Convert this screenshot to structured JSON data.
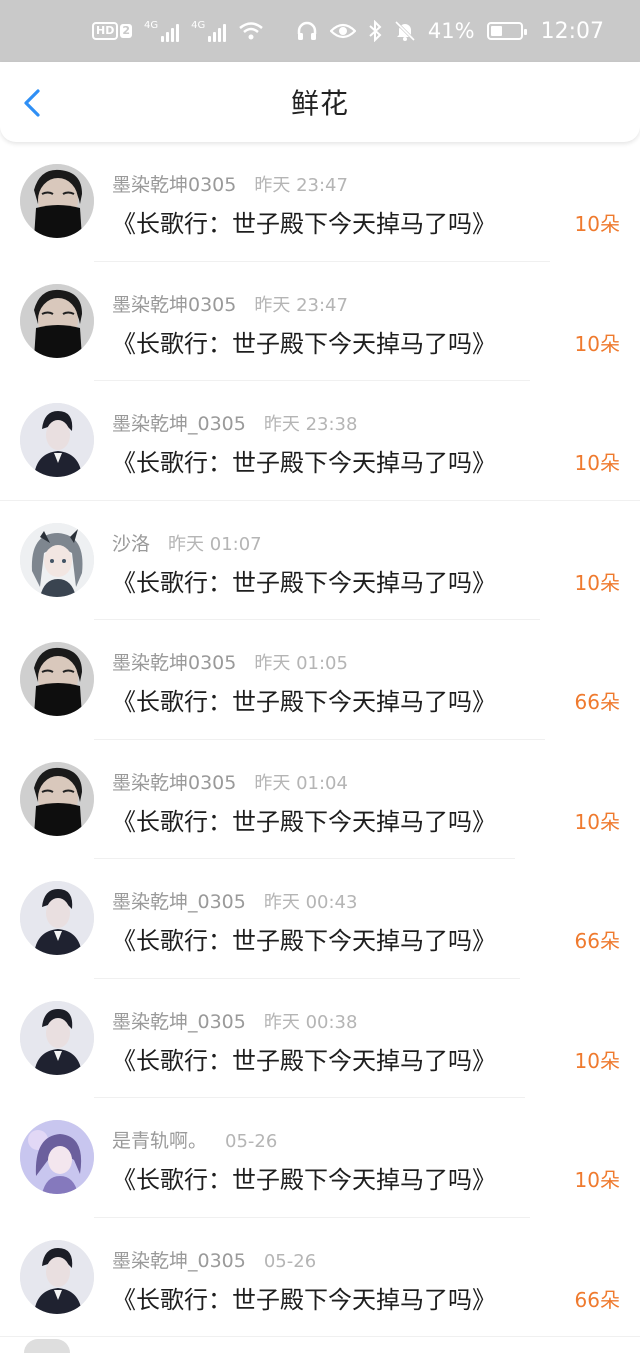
{
  "status": {
    "hd": "HD",
    "sim": "2",
    "net1": "4G",
    "net2": "4G",
    "battery_pct": "41%",
    "battery_level": 0.41,
    "time": "12:07",
    "icons": [
      "headphones-icon",
      "eye-icon",
      "bluetooth-icon",
      "bell-off-icon",
      "wifi-icon"
    ]
  },
  "nav": {
    "title": "鲜花",
    "back_icon": "chevron-left-icon"
  },
  "colors": {
    "accent": "#2f8ff5",
    "count": "#ef7a2e"
  },
  "items": [
    {
      "name": "墨染乾坤0305",
      "time": "昨天 23:47",
      "book": "《长歌行：世子殿下今天掉马了吗》",
      "count": "10朵",
      "avatar": "avatar-masked-man"
    },
    {
      "name": "墨染乾坤0305",
      "time": "昨天 23:47",
      "book": "《长歌行：世子殿下今天掉马了吗》",
      "count": "10朵",
      "avatar": "avatar-masked-man"
    },
    {
      "name": "墨染乾坤_0305",
      "time": "昨天 23:38",
      "book": "《长歌行：世子殿下今天掉马了吗》",
      "count": "10朵",
      "avatar": "avatar-dark-suit"
    },
    {
      "name": "沙洛",
      "time": "昨天 01:07",
      "book": "《长歌行：世子殿下今天掉马了吗》",
      "count": "10朵",
      "avatar": "avatar-anime-girl"
    },
    {
      "name": "墨染乾坤0305",
      "time": "昨天 01:05",
      "book": "《长歌行：世子殿下今天掉马了吗》",
      "count": "66朵",
      "avatar": "avatar-masked-man"
    },
    {
      "name": "墨染乾坤0305",
      "time": "昨天 01:04",
      "book": "《长歌行：世子殿下今天掉马了吗》",
      "count": "10朵",
      "avatar": "avatar-masked-man"
    },
    {
      "name": "墨染乾坤_0305",
      "time": "昨天 00:43",
      "book": "《长歌行：世子殿下今天掉马了吗》",
      "count": "66朵",
      "avatar": "avatar-dark-suit"
    },
    {
      "name": "墨染乾坤_0305",
      "time": "昨天 00:38",
      "book": "《长歌行：世子殿下今天掉马了吗》",
      "count": "10朵",
      "avatar": "avatar-dark-suit"
    },
    {
      "name": "是青轨啊。",
      "time": "05-26",
      "book": "《长歌行：世子殿下今天掉马了吗》",
      "count": "10朵",
      "avatar": "avatar-purple-girl"
    },
    {
      "name": "墨染乾坤_0305",
      "time": "05-26",
      "book": "《长歌行：世子殿下今天掉马了吗》",
      "count": "66朵",
      "avatar": "avatar-dark-suit"
    }
  ]
}
